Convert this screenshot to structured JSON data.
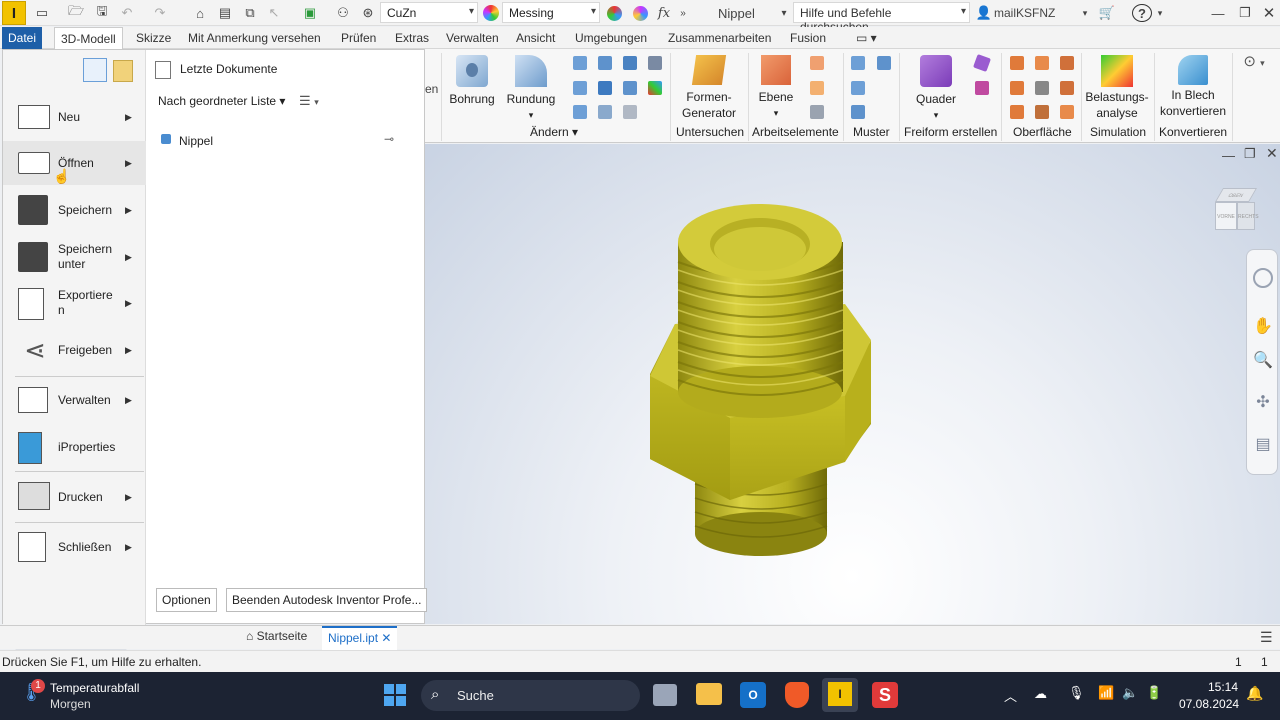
{
  "qat": {
    "material": "CuZn",
    "appearance": "Messing",
    "fx_label": "fx",
    "document": "Nippel",
    "search_placeholder": "Hilfe und Befehle durchsuchen...",
    "user": "mailKSFNZ"
  },
  "menubar": {
    "tabs": [
      "Datei",
      "3D-Modell",
      "Skizze",
      "Mit Anmerkung versehen",
      "Prüfen",
      "Extras",
      "Verwalten",
      "Ansicht",
      "Umgebungen",
      "Zusammenarbeiten",
      "Fusion"
    ]
  },
  "ribbon": {
    "bohrung": "Bohrung",
    "rundung": "Rundung",
    "aendern": "Ändern",
    "formen_generator_1": "Formen-",
    "formen_generator_2": "Generator",
    "untersuchen": "Untersuchen",
    "ebene": "Ebene",
    "arbeitselemente": "Arbeitselemente",
    "muster": "Muster",
    "quader": "Quader",
    "freiform": "Freiform erstellen",
    "oberflaeche": "Oberfläche",
    "belastung_1": "Belastungs-",
    "belastung_2": "analyse",
    "simulation": "Simulation",
    "blech_1": "In Blech",
    "blech_2": "konvertieren",
    "konvertieren": "Konvertieren",
    "partial_left": "en"
  },
  "appmenu": {
    "items": [
      {
        "label": "Neu"
      },
      {
        "label": "Öffnen"
      },
      {
        "label": "Speichern"
      },
      {
        "label": "Speichern\nunter"
      },
      {
        "label": "Exportiere\nn"
      },
      {
        "label": "Freigeben"
      },
      {
        "label": "Verwalten"
      },
      {
        "label": "iProperties"
      },
      {
        "label": "Drucken"
      },
      {
        "label": "Schließen"
      }
    ],
    "recent_title": "Letzte Dokumente",
    "sort_label": "Nach geordneter Liste",
    "recent_docs": [
      "Nippel"
    ],
    "options_button": "Optionen",
    "exit_button": "Beenden Autodesk Inventor Profe..."
  },
  "doctabs": {
    "home": "Startseite",
    "active": "Nippel.ipt"
  },
  "status": {
    "hint": "Drücken Sie F1, um Hilfe zu erhalten.",
    "count1": "1",
    "count2": "1"
  },
  "viewcube": {
    "top": "OBEN",
    "front": "VORNE",
    "right": "RECHTS"
  },
  "taskbar": {
    "weather_title": "Temperaturabfall",
    "weather_sub": "Morgen",
    "weather_badge": "1",
    "search": "Suche",
    "time": "15:14",
    "date": "07.08.2024"
  },
  "colors": {
    "accent": "#1e6fc8",
    "part": "#c9c21a",
    "datei_tab": "#1e5fa8"
  }
}
